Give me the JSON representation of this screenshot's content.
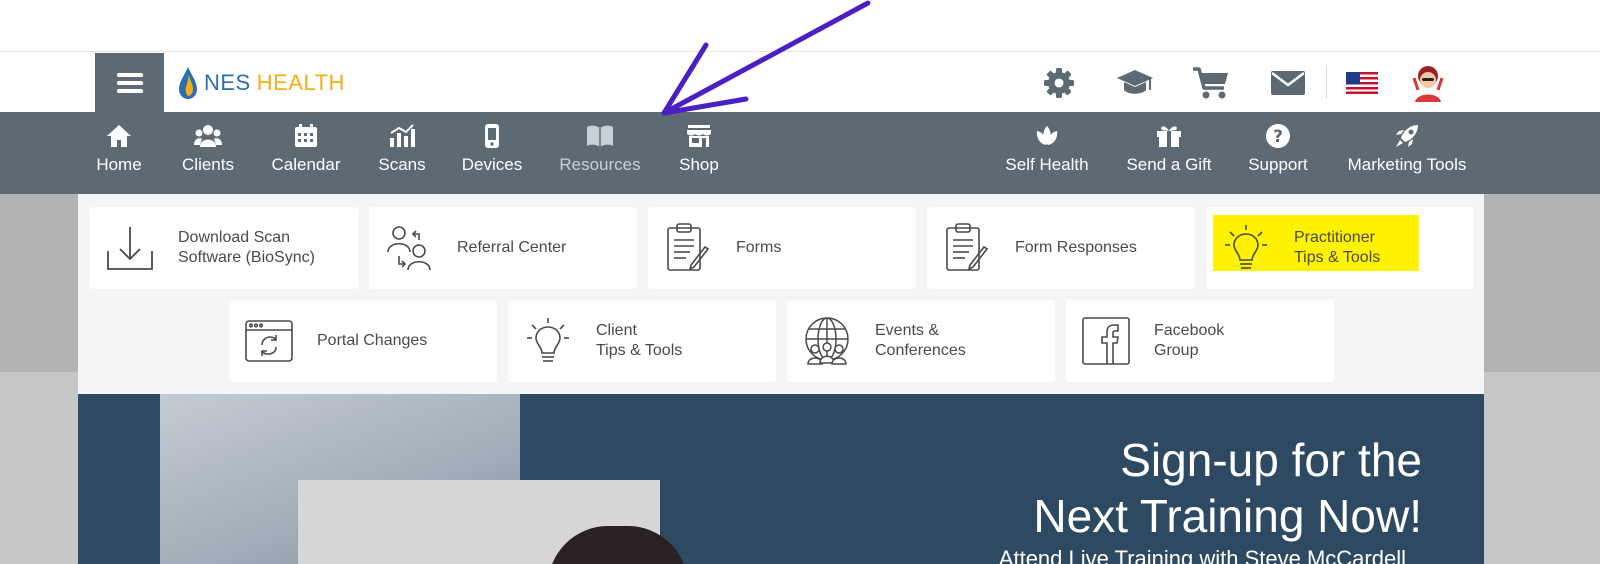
{
  "header": {
    "logo_text_1": "NES",
    "logo_text_2": "HEALTH",
    "icons": [
      "menu-icon",
      "settings-icon",
      "graduation-cap-icon",
      "cart-icon",
      "mail-icon",
      "us-flag-icon",
      "avatar"
    ]
  },
  "nav": {
    "left": [
      {
        "label": "Home",
        "icon": "home-icon"
      },
      {
        "label": "Clients",
        "icon": "clients-icon"
      },
      {
        "label": "Calendar",
        "icon": "calendar-icon"
      },
      {
        "label": "Scans",
        "icon": "scans-icon"
      },
      {
        "label": "Devices",
        "icon": "device-icon"
      },
      {
        "label": "Resources",
        "icon": "book-icon"
      },
      {
        "label": "Shop",
        "icon": "store-icon"
      }
    ],
    "right": [
      {
        "label": "Self Health",
        "icon": "lotus-icon"
      },
      {
        "label": "Send a Gift",
        "icon": "gift-icon"
      },
      {
        "label": "Support",
        "icon": "help-icon"
      },
      {
        "label": "Marketing Tools",
        "icon": "rocket-icon"
      }
    ],
    "active": "Resources"
  },
  "resources_menu": {
    "row1": [
      {
        "label": "Download Scan\nSoftware (BioSync)",
        "icon": "download-icon"
      },
      {
        "label": "Referral Center",
        "icon": "people-icon"
      },
      {
        "label": "Forms",
        "icon": "clipboard-icon"
      },
      {
        "label": "Form Responses",
        "icon": "clipboard-icon"
      },
      {
        "label": "Practitioner\nTips & Tools",
        "icon": "lightbulb-icon",
        "highlighted": true
      }
    ],
    "row2": [
      {
        "label": "Portal Changes",
        "icon": "browser-refresh-icon"
      },
      {
        "label": "Client\nTips & Tools",
        "icon": "lightbulb-icon"
      },
      {
        "label": "Events &\nConferences",
        "icon": "globe-people-icon"
      },
      {
        "label": "Facebook\nGroup",
        "icon": "facebook-icon"
      }
    ]
  },
  "banner": {
    "title_line1": "Sign-up for the",
    "title_line2": "Next Training Now!",
    "subtitle": "Attend Live Training with Steve McCardell"
  },
  "colors": {
    "navbar": "#5d6a73",
    "brand_blue": "#2b6fad",
    "brand_orange": "#f2ae1c",
    "highlight": "#fff200",
    "annotation_arrow": "#4a1fc4"
  }
}
